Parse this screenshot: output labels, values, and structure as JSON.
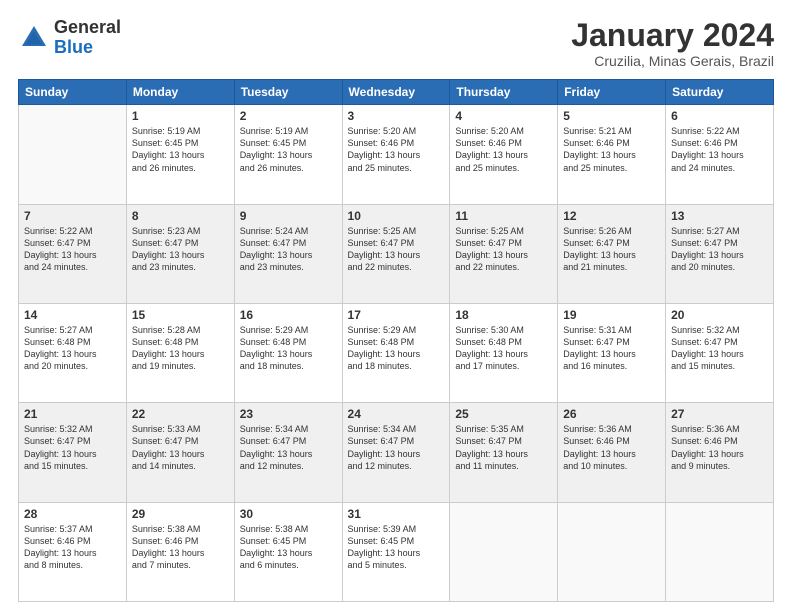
{
  "logo": {
    "general": "General",
    "blue": "Blue"
  },
  "title": "January 2024",
  "location": "Cruzilia, Minas Gerais, Brazil",
  "weekdays": [
    "Sunday",
    "Monday",
    "Tuesday",
    "Wednesday",
    "Thursday",
    "Friday",
    "Saturday"
  ],
  "weeks": [
    [
      {
        "day": "",
        "empty": true
      },
      {
        "day": "1",
        "sunrise": "5:19 AM",
        "sunset": "6:45 PM",
        "daylight": "13 hours and 26 minutes."
      },
      {
        "day": "2",
        "sunrise": "5:19 AM",
        "sunset": "6:45 PM",
        "daylight": "13 hours and 26 minutes."
      },
      {
        "day": "3",
        "sunrise": "5:20 AM",
        "sunset": "6:46 PM",
        "daylight": "13 hours and 25 minutes."
      },
      {
        "day": "4",
        "sunrise": "5:20 AM",
        "sunset": "6:46 PM",
        "daylight": "13 hours and 25 minutes."
      },
      {
        "day": "5",
        "sunrise": "5:21 AM",
        "sunset": "6:46 PM",
        "daylight": "13 hours and 25 minutes."
      },
      {
        "day": "6",
        "sunrise": "5:22 AM",
        "sunset": "6:46 PM",
        "daylight": "13 hours and 24 minutes."
      }
    ],
    [
      {
        "day": "7",
        "sunrise": "5:22 AM",
        "sunset": "6:47 PM",
        "daylight": "13 hours and 24 minutes."
      },
      {
        "day": "8",
        "sunrise": "5:23 AM",
        "sunset": "6:47 PM",
        "daylight": "13 hours and 23 minutes."
      },
      {
        "day": "9",
        "sunrise": "5:24 AM",
        "sunset": "6:47 PM",
        "daylight": "13 hours and 23 minutes."
      },
      {
        "day": "10",
        "sunrise": "5:25 AM",
        "sunset": "6:47 PM",
        "daylight": "13 hours and 22 minutes."
      },
      {
        "day": "11",
        "sunrise": "5:25 AM",
        "sunset": "6:47 PM",
        "daylight": "13 hours and 22 minutes."
      },
      {
        "day": "12",
        "sunrise": "5:26 AM",
        "sunset": "6:47 PM",
        "daylight": "13 hours and 21 minutes."
      },
      {
        "day": "13",
        "sunrise": "5:27 AM",
        "sunset": "6:47 PM",
        "daylight": "13 hours and 20 minutes."
      }
    ],
    [
      {
        "day": "14",
        "sunrise": "5:27 AM",
        "sunset": "6:48 PM",
        "daylight": "13 hours and 20 minutes."
      },
      {
        "day": "15",
        "sunrise": "5:28 AM",
        "sunset": "6:48 PM",
        "daylight": "13 hours and 19 minutes."
      },
      {
        "day": "16",
        "sunrise": "5:29 AM",
        "sunset": "6:48 PM",
        "daylight": "13 hours and 18 minutes."
      },
      {
        "day": "17",
        "sunrise": "5:29 AM",
        "sunset": "6:48 PM",
        "daylight": "13 hours and 18 minutes."
      },
      {
        "day": "18",
        "sunrise": "5:30 AM",
        "sunset": "6:48 PM",
        "daylight": "13 hours and 17 minutes."
      },
      {
        "day": "19",
        "sunrise": "5:31 AM",
        "sunset": "6:47 PM",
        "daylight": "13 hours and 16 minutes."
      },
      {
        "day": "20",
        "sunrise": "5:32 AM",
        "sunset": "6:47 PM",
        "daylight": "13 hours and 15 minutes."
      }
    ],
    [
      {
        "day": "21",
        "sunrise": "5:32 AM",
        "sunset": "6:47 PM",
        "daylight": "13 hours and 15 minutes."
      },
      {
        "day": "22",
        "sunrise": "5:33 AM",
        "sunset": "6:47 PM",
        "daylight": "13 hours and 14 minutes."
      },
      {
        "day": "23",
        "sunrise": "5:34 AM",
        "sunset": "6:47 PM",
        "daylight": "13 hours and 12 minutes."
      },
      {
        "day": "24",
        "sunrise": "5:34 AM",
        "sunset": "6:47 PM",
        "daylight": "13 hours and 12 minutes."
      },
      {
        "day": "25",
        "sunrise": "5:35 AM",
        "sunset": "6:47 PM",
        "daylight": "13 hours and 11 minutes."
      },
      {
        "day": "26",
        "sunrise": "5:36 AM",
        "sunset": "6:46 PM",
        "daylight": "13 hours and 10 minutes."
      },
      {
        "day": "27",
        "sunrise": "5:36 AM",
        "sunset": "6:46 PM",
        "daylight": "13 hours and 9 minutes."
      }
    ],
    [
      {
        "day": "28",
        "sunrise": "5:37 AM",
        "sunset": "6:46 PM",
        "daylight": "13 hours and 8 minutes."
      },
      {
        "day": "29",
        "sunrise": "5:38 AM",
        "sunset": "6:46 PM",
        "daylight": "13 hours and 7 minutes."
      },
      {
        "day": "30",
        "sunrise": "5:38 AM",
        "sunset": "6:45 PM",
        "daylight": "13 hours and 6 minutes."
      },
      {
        "day": "31",
        "sunrise": "5:39 AM",
        "sunset": "6:45 PM",
        "daylight": "13 hours and 5 minutes."
      },
      {
        "day": "",
        "empty": true
      },
      {
        "day": "",
        "empty": true
      },
      {
        "day": "",
        "empty": true
      }
    ]
  ]
}
